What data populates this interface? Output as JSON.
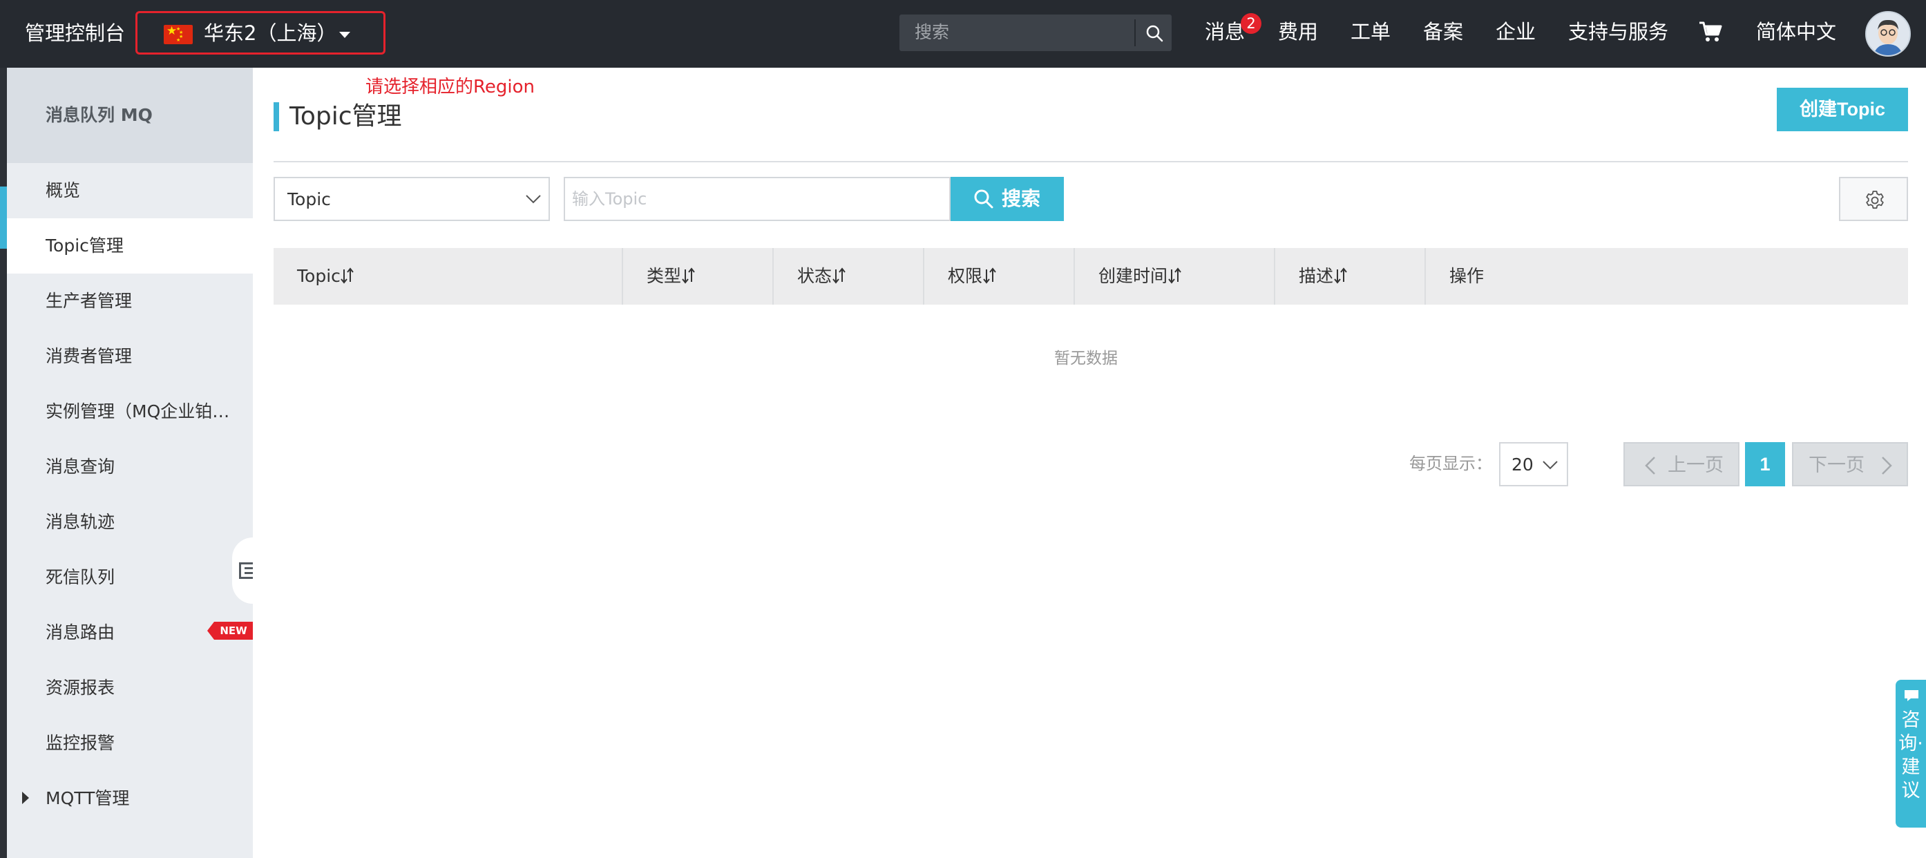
{
  "topbar": {
    "console_title": "管理控制台",
    "region": "华东2（上海）",
    "search_placeholder": "搜索",
    "nav": {
      "messages": "消息",
      "messages_badge": "2",
      "billing": "费用",
      "tickets": "工单",
      "icp": "备案",
      "enterprise": "企业",
      "support": "支持与服务",
      "language": "简体中文"
    }
  },
  "sidebar": {
    "product": "消息队列 MQ",
    "items": [
      {
        "label": "概览"
      },
      {
        "label": "Topic管理"
      },
      {
        "label": "生产者管理"
      },
      {
        "label": "消费者管理"
      },
      {
        "label": "实例管理（MQ企业铂…"
      },
      {
        "label": "消息查询"
      },
      {
        "label": "消息轨迹"
      },
      {
        "label": "死信队列"
      },
      {
        "label": "消息路由",
        "badge": "NEW"
      },
      {
        "label": "资源报表"
      },
      {
        "label": "监控报警"
      },
      {
        "label": "MQTT管理"
      }
    ]
  },
  "main": {
    "region_tip": "请选择相应的Region",
    "page_title": "Topic管理",
    "create_button": "创建Topic",
    "filter": {
      "select_value": "Topic",
      "input_placeholder": "输入Topic",
      "search_button": "搜索"
    },
    "table": {
      "columns": [
        "Topic",
        "类型",
        "状态",
        "权限",
        "创建时间",
        "描述",
        "操作"
      ],
      "empty_text": "暂无数据"
    },
    "pagination": {
      "per_page_label": "每页显示：",
      "per_page_value": "20",
      "prev": "上一页",
      "current": "1",
      "next": "下一页"
    },
    "consult_tab": "咨询·建议"
  },
  "colors": {
    "topbar_bg": "#262a30",
    "accent": "#3cbad6",
    "alert_red": "#e5222c",
    "sidebar_bg": "#eaedf1"
  },
  "icons": [
    "china-flag-icon",
    "caret-down-icon",
    "search-icon",
    "cart-icon",
    "avatar",
    "collapse-icon",
    "sort-icon",
    "gear-icon",
    "chevron-left-icon",
    "chevron-right-icon",
    "chat-icon"
  ]
}
